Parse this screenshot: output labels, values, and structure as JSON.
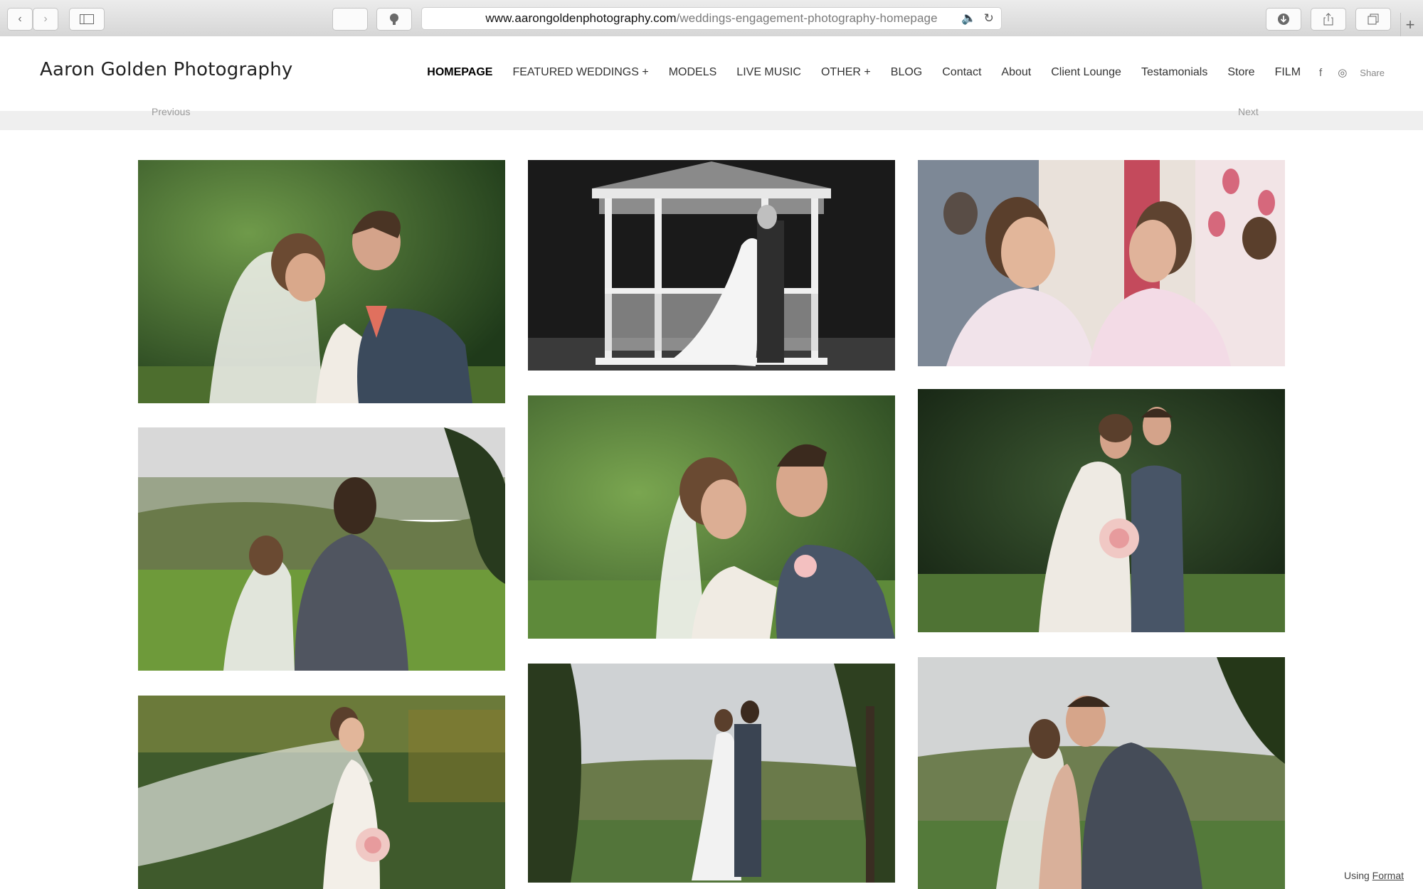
{
  "browser": {
    "url_domain": "www.aarongoldenphotography.com",
    "url_path": "/weddings-engagement-photography-homepage",
    "icons": [
      "back-icon",
      "forward-icon",
      "sidebar-icon",
      "shield-icon",
      "speaker-icon",
      "reload-icon",
      "download-icon",
      "share-icon",
      "tabs-icon",
      "new-tab-icon"
    ]
  },
  "site": {
    "title": "Aaron Golden Photography",
    "nav": [
      {
        "label": "HOMEPAGE",
        "active": true
      },
      {
        "label": "FEATURED WEDDINGS +"
      },
      {
        "label": "MODELS"
      },
      {
        "label": "LIVE MUSIC"
      },
      {
        "label": "OTHER +"
      },
      {
        "label": "BLOG"
      },
      {
        "label": "Contact"
      },
      {
        "label": "About"
      },
      {
        "label": "Client Lounge"
      },
      {
        "label": "Testamonials"
      },
      {
        "label": "Store"
      },
      {
        "label": "FILM"
      }
    ],
    "social": {
      "facebook": "f",
      "instagram": "◎",
      "share": "Share"
    }
  },
  "pager": {
    "previous": "Previous",
    "next": "Next"
  },
  "gallery": {
    "photos": [
      {
        "name": "photo-couple-embrace-green"
      },
      {
        "name": "photo-gazebo-kiss-bw"
      },
      {
        "name": "photo-bride-mirror-robes"
      },
      {
        "name": "photo-couple-valley-back"
      },
      {
        "name": "photo-couple-smile-closeup"
      },
      {
        "name": "photo-couple-standing-bouquet"
      },
      {
        "name": "photo-bride-veil-bouquet"
      },
      {
        "name": "photo-couple-trees-view"
      },
      {
        "name": "photo-couple-kiss-valley"
      }
    ]
  },
  "footer": {
    "using": "Using",
    "format": "Format"
  }
}
